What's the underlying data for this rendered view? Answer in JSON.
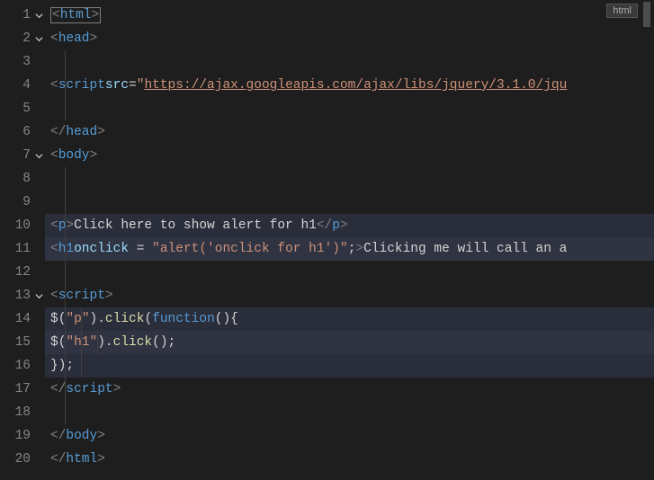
{
  "language_badge": "html",
  "lines": [
    {
      "num": "1",
      "fold": "v"
    },
    {
      "num": "2",
      "fold": "v"
    },
    {
      "num": "3",
      "fold": ""
    },
    {
      "num": "4",
      "fold": ""
    },
    {
      "num": "5",
      "fold": ""
    },
    {
      "num": "6",
      "fold": ""
    },
    {
      "num": "7",
      "fold": "v"
    },
    {
      "num": "8",
      "fold": ""
    },
    {
      "num": "9",
      "fold": ""
    },
    {
      "num": "10",
      "fold": ""
    },
    {
      "num": "11",
      "fold": ""
    },
    {
      "num": "12",
      "fold": ""
    },
    {
      "num": "13",
      "fold": "v"
    },
    {
      "num": "14",
      "fold": ""
    },
    {
      "num": "15",
      "fold": ""
    },
    {
      "num": "16",
      "fold": ""
    },
    {
      "num": "17",
      "fold": ""
    },
    {
      "num": "18",
      "fold": ""
    },
    {
      "num": "19",
      "fold": ""
    },
    {
      "num": "20",
      "fold": ""
    }
  ],
  "code": {
    "l1": {
      "open_br": "<",
      "tag": "html",
      "close_br": ">"
    },
    "l2": {
      "open": "<",
      "tag": "head",
      "close": ">"
    },
    "l4": {
      "open": "<",
      "tag": "script",
      "attr": "src",
      "eq": "=",
      "q": "\"",
      "url": "https://ajax.googleapis.com/ajax/libs/jquery/3.1.0/jqu"
    },
    "l6": {
      "open": "</",
      "tag": "head",
      "close": ">"
    },
    "l7": {
      "open": "<",
      "tag": "body",
      "close": ">"
    },
    "l10": {
      "open": "<",
      "tag": "p",
      "close": ">",
      "text": "Click here to show alert for h1",
      "open2": "</",
      "tag2": "p",
      "close2": ">"
    },
    "l11": {
      "open": "<",
      "tag": "h1",
      "attr": "onclick",
      "sp_eq": " = ",
      "q": "\"",
      "str": "alert('onclick for h1')",
      "q2": "\"",
      "semi": ";",
      "close": ">",
      "text": "Clicking me will call an a"
    },
    "l13": {
      "open": "<",
      "tag": "script",
      "close": ">"
    },
    "l14": {
      "jq": "$(",
      "q": "\"",
      "sel": "p",
      "q2": "\"",
      "rp": ").",
      "fn": "click",
      "lp2": "(",
      "kw": "function",
      "paren": "(){"
    },
    "l15": {
      "jq": "$(",
      "q": "\"",
      "sel": "h1",
      "q2": "\"",
      "rp": ").",
      "fn": "click",
      "tail": "();"
    },
    "l16": {
      "closebrace": "});"
    },
    "l17": {
      "open": "</",
      "tag": "script",
      "close": ">"
    },
    "l19": {
      "open": "</",
      "tag": "body",
      "close": ">"
    },
    "l20": {
      "open": "</",
      "tag": "html",
      "close": ">"
    }
  }
}
